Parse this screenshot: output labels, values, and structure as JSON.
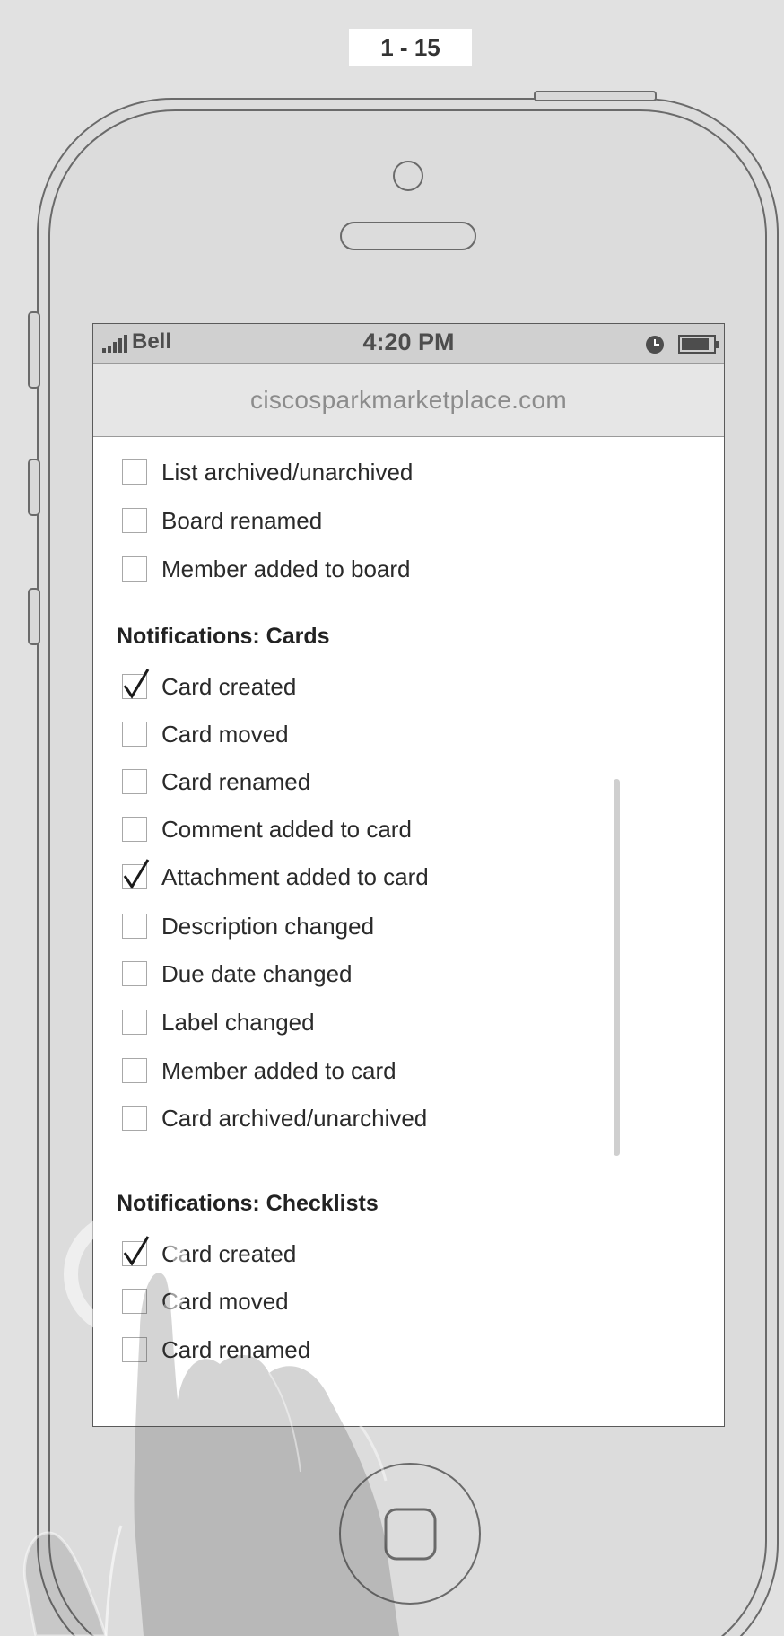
{
  "page_label": "1 - 15",
  "status_bar": {
    "carrier": "Bell",
    "time": "4:20 PM",
    "icons": [
      "signal-icon",
      "clock-icon",
      "battery-icon"
    ]
  },
  "url_bar": {
    "url": "ciscosparkmarketplace.com"
  },
  "board_items": [
    {
      "label": "List archived/unarchived",
      "checked": false
    },
    {
      "label": "Board renamed",
      "checked": false
    },
    {
      "label": "Member added to board",
      "checked": false
    }
  ],
  "cards": {
    "heading": "Notifications: Cards",
    "items": [
      {
        "label": "Card created",
        "checked": true
      },
      {
        "label": "Card moved",
        "checked": false
      },
      {
        "label": "Card renamed",
        "checked": false
      },
      {
        "label": "Comment added to card",
        "checked": false
      },
      {
        "label": "Attachment added to card",
        "checked": true
      },
      {
        "label": "Description changed",
        "checked": false
      },
      {
        "label": "Due date changed",
        "checked": false
      },
      {
        "label": "Label changed",
        "checked": false
      },
      {
        "label": "Member added to card",
        "checked": false
      },
      {
        "label": "Card archived/unarchived",
        "checked": false
      }
    ]
  },
  "checklists": {
    "heading": "Notifications: Checklists",
    "items": [
      {
        "label": "Card created",
        "checked": true
      },
      {
        "label": "Card moved",
        "checked": false
      },
      {
        "label": "Card renamed",
        "checked": false
      }
    ]
  },
  "colors": {
    "background": "#e1e1e1",
    "phone_body": "#dcdcdc",
    "phone_outline": "#5a5a5a",
    "screen": "#ffffff",
    "status_bar": "#d0d0d0"
  }
}
